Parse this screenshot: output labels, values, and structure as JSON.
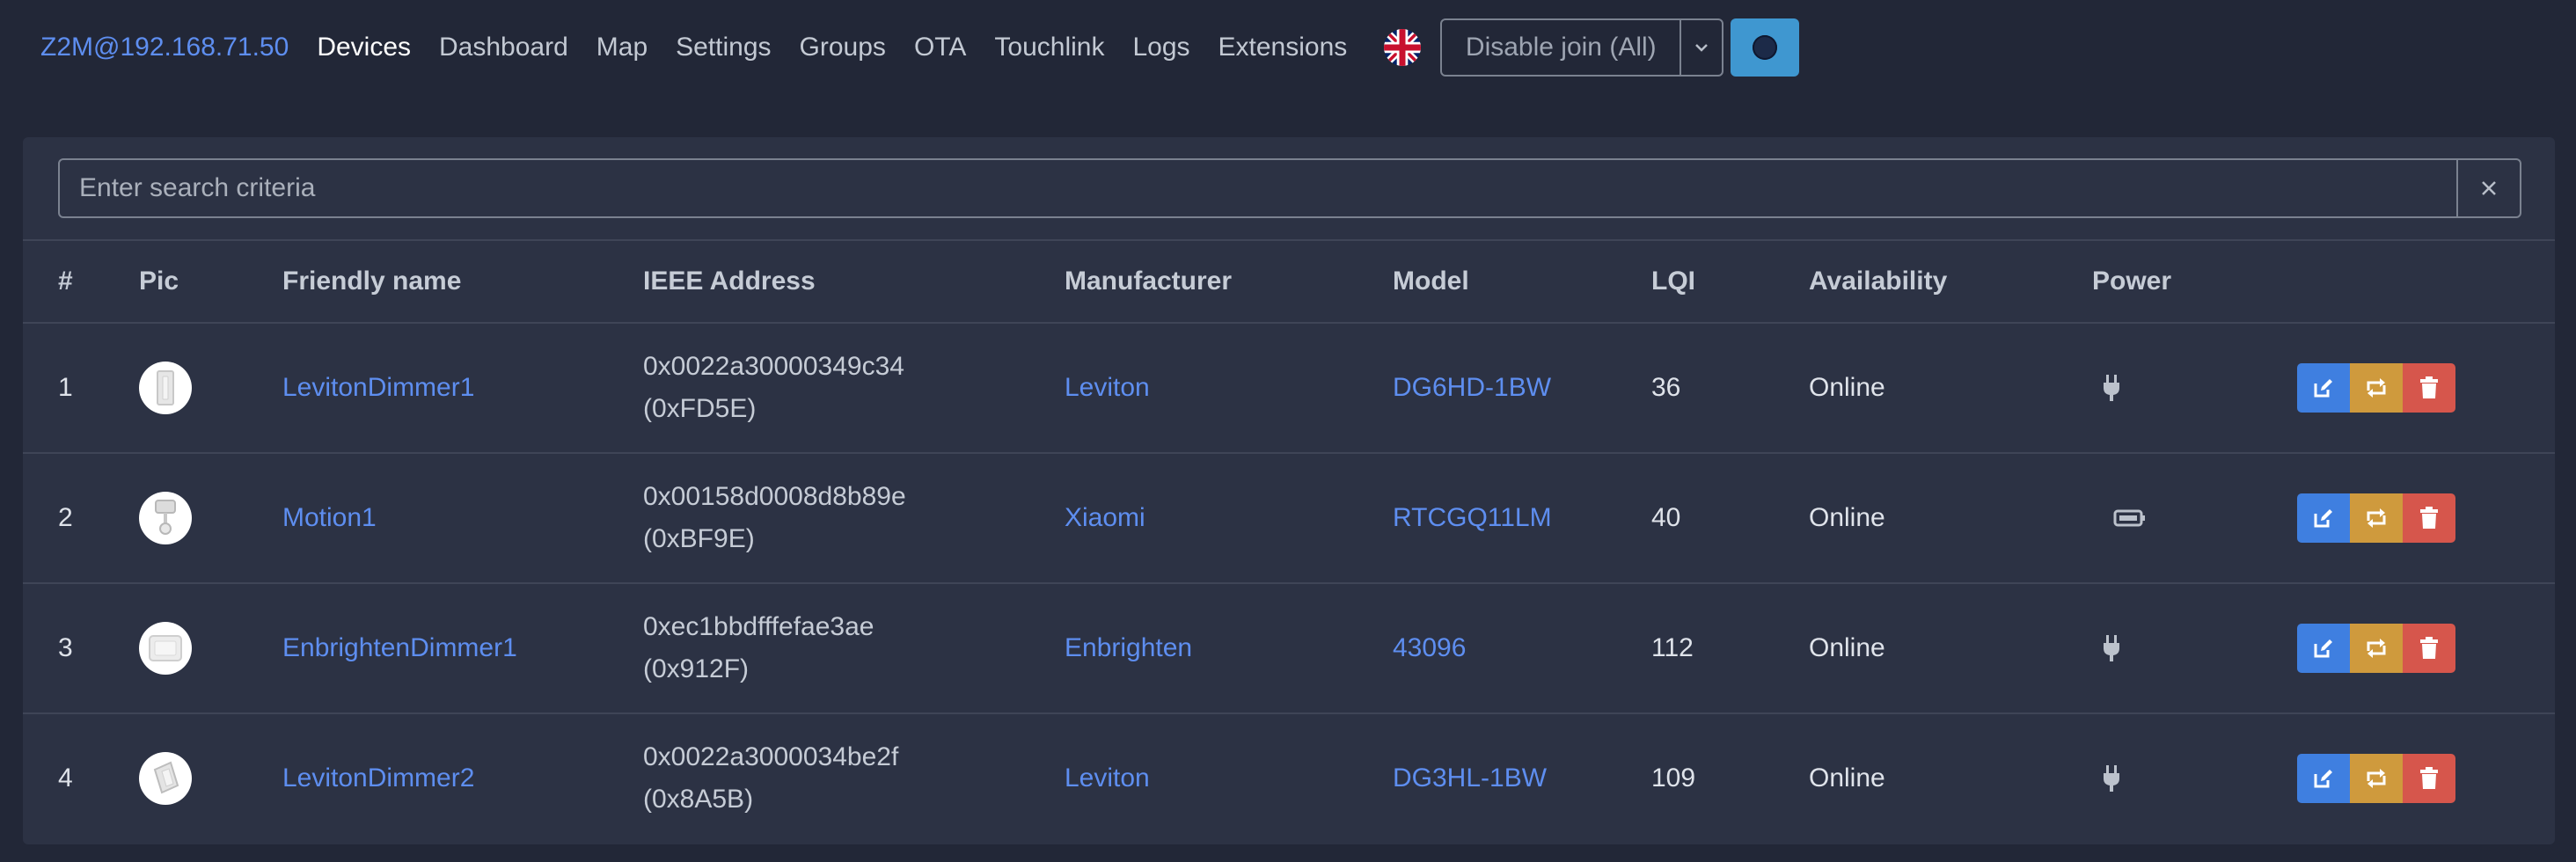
{
  "nav": {
    "brand": "Z2M@192.168.71.50",
    "links": [
      "Devices",
      "Dashboard",
      "Map",
      "Settings",
      "Groups",
      "OTA",
      "Touchlink",
      "Logs",
      "Extensions"
    ],
    "join_label": "Disable join (All)",
    "flag_icon": "uk-flag-icon",
    "theme_icon": "moon-icon"
  },
  "search": {
    "placeholder": "Enter search criteria",
    "value": ""
  },
  "table": {
    "headers": [
      "#",
      "Pic",
      "Friendly name",
      "IEEE Address",
      "Manufacturer",
      "Model",
      "LQI",
      "Availability",
      "Power"
    ],
    "rows": [
      {
        "num": "1",
        "name": "LevitonDimmer1",
        "ieee": "0x0022a30000349c34",
        "nwk": "(0xFD5E)",
        "manufacturer": "Leviton",
        "model": "DG6HD-1BW",
        "lqi": "36",
        "availability": "Online",
        "power": "plug-icon"
      },
      {
        "num": "2",
        "name": "Motion1",
        "ieee": "0x00158d0008d8b89e",
        "nwk": "(0xBF9E)",
        "manufacturer": "Xiaomi",
        "model": "RTCGQ11LM",
        "lqi": "40",
        "availability": "Online",
        "power": "battery-icon"
      },
      {
        "num": "3",
        "name": "EnbrightenDimmer1",
        "ieee": "0xec1bbdfffefae3ae",
        "nwk": "(0x912F)",
        "manufacturer": "Enbrighten",
        "model": "43096",
        "lqi": "112",
        "availability": "Online",
        "power": "plug-icon"
      },
      {
        "num": "4",
        "name": "LevitonDimmer2",
        "ieee": "0x0022a3000034be2f",
        "nwk": "(0x8A5B)",
        "manufacturer": "Leviton",
        "model": "DG3HL-1BW",
        "lqi": "109",
        "availability": "Online",
        "power": "plug-icon"
      }
    ]
  },
  "colors": {
    "background": "#222737",
    "card": "#2c3244",
    "link": "#5e8ef0",
    "edit": "#3f7fe0",
    "rename": "#cf9a3d",
    "delete": "#d6564c",
    "theme_button": "#3f97d0"
  }
}
